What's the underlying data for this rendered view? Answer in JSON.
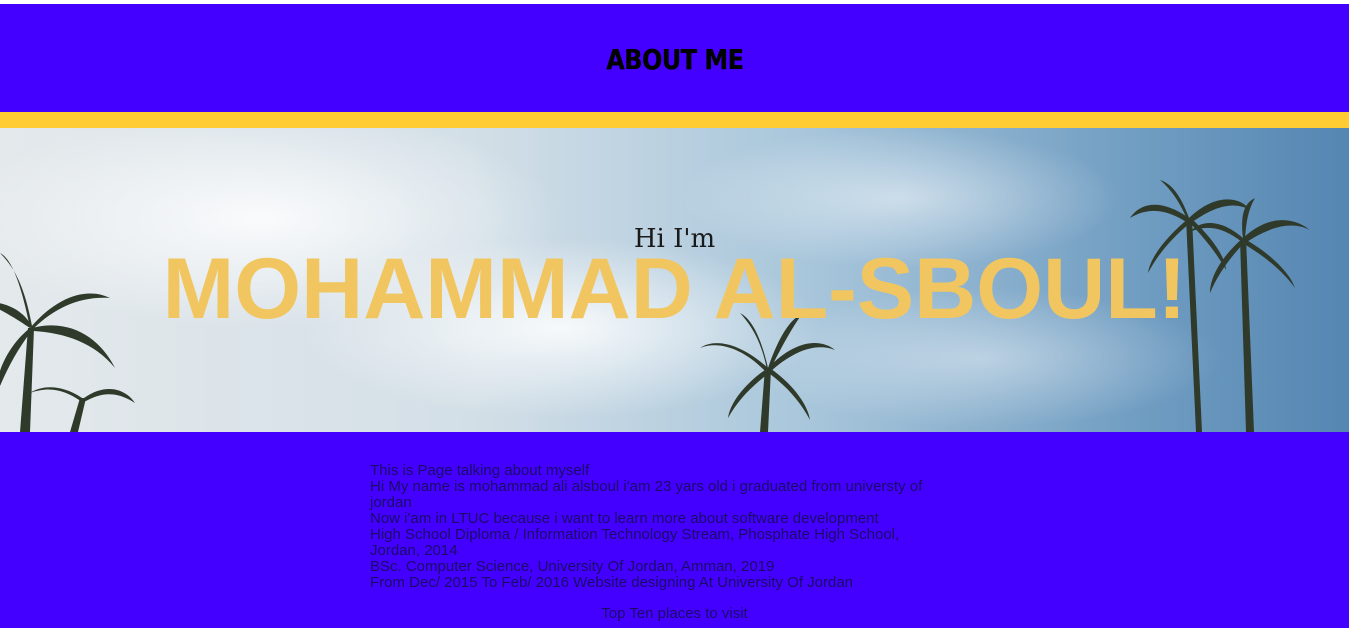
{
  "header": {
    "title": "ABOUT ME"
  },
  "hero": {
    "greeting": "Hi I'm",
    "name": "MOHAMMAD AL-SBOUL!"
  },
  "bio": {
    "intro": "This is Page talking about myself",
    "about": "Hi My name is mohammad ali alsboul i'am 23 yars old i graduated from universty of jordan",
    "ltuc": "Now i'am in LTUC because i want to learn more about software development",
    "highschool": "High School Diploma / Information Technology Stream, Phosphate High School, Jordan, 2014",
    "bsc": "BSc. Computer Science, University Of Jordan, Amman, 2019",
    "experience": "From Dec/ 2015 To Feb/ 2016 Website designing At University Of Jordan"
  },
  "footer": {
    "places_link": "Top Ten places to visit"
  },
  "colors": {
    "header_bg": "#4400ff",
    "stripe": "#ffcc33",
    "name_text": "#f1c660"
  }
}
